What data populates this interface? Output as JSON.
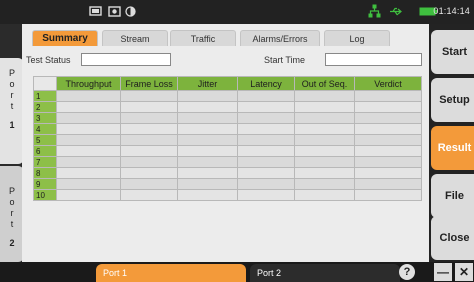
{
  "statusbar": {
    "clock": "01:14:14",
    "icons": [
      "display-icon",
      "camera-icon",
      "brightness-icon",
      "network-icon",
      "usb-icon",
      "battery-icon"
    ]
  },
  "ports_side": [
    {
      "letters": [
        "P",
        "o",
        "r",
        "t"
      ],
      "number": "1"
    },
    {
      "letters": [
        "P",
        "o",
        "r",
        "t"
      ],
      "number": "2"
    }
  ],
  "tabs": [
    {
      "label": "Summary",
      "active": true
    },
    {
      "label": "Stream",
      "active": false
    },
    {
      "label": "Traffic",
      "active": false
    },
    {
      "label": "Alarms/Errors",
      "active": false
    },
    {
      "label": "Log",
      "active": false
    }
  ],
  "fields": {
    "test_status_label": "Test Status",
    "test_status_value": "",
    "start_time_label": "Start Time",
    "start_time_value": ""
  },
  "table": {
    "columns": [
      "Throughput",
      "Frame Loss",
      "Jitter",
      "Latency",
      "Out of Seq.",
      "Verdict"
    ],
    "rows": [
      "1",
      "2",
      "3",
      "4",
      "5",
      "6",
      "7",
      "8",
      "9",
      "10"
    ]
  },
  "side_buttons": [
    {
      "label": "Start",
      "active": false
    },
    {
      "label": "Setup",
      "active": false
    },
    {
      "label": "Result",
      "active": true
    },
    {
      "label": "File",
      "active": false
    },
    {
      "label": "Close",
      "active": false
    }
  ],
  "bottom": {
    "port1": "Port 1",
    "port2": "Port 2",
    "help": "?",
    "minimize": "—",
    "close": "✕"
  },
  "colors": {
    "accent": "#f39a3a",
    "header_green": "#7db33d",
    "network_green": "#3fbf3f"
  }
}
